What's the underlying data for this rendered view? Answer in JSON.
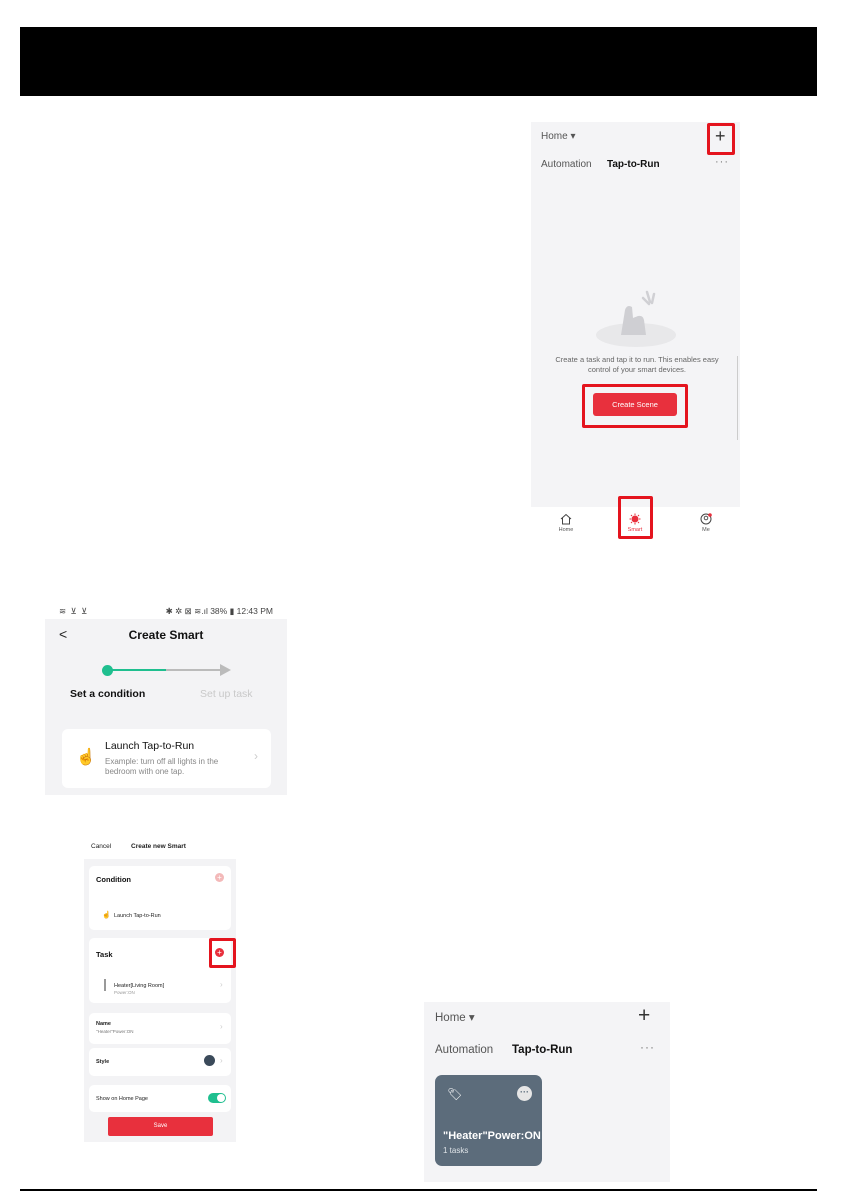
{
  "colors": {
    "accent_red": "#e8303d",
    "highlight_red": "#e4141e",
    "accent_green": "#1fbf8f",
    "card_slate": "#5c6c7b"
  },
  "screen1": {
    "home_label": "Home",
    "plus_icon": "+",
    "tab_automation": "Automation",
    "tab_tap": "Tap-to-Run",
    "more_dots": "···",
    "empty_text": "Create a task and tap it to run. This enables easy control of your smart devices.",
    "create_button": "Create Scene",
    "tabbar": [
      {
        "label": "Home",
        "icon": "house-icon"
      },
      {
        "label": "Smart",
        "icon": "smart-sun-icon"
      },
      {
        "label": "Me",
        "icon": "profile-icon"
      }
    ]
  },
  "screen2": {
    "status_left": "≋ ⊻ ⊻",
    "status_right": "✱ ✲ ⊠ ≋.ıl 38% ▮ 12:43 PM",
    "back": "<",
    "title": "Create Smart",
    "step1": "Set a condition",
    "step2": "Set up task",
    "card_label": "Launch Tap-to-Run",
    "card_desc": "Example: turn off all lights in the bedroom with one tap."
  },
  "screen3": {
    "cancel": "Cancel",
    "title": "Create new Smart",
    "condition_header": "Condition",
    "condition_item": "Launch Tap-to-Run",
    "task_header": "Task",
    "task_item": "Heater[Living Room]",
    "task_sub": "Power:ON",
    "name_label": "Name",
    "name_value": "\"Heater\"Power:ON",
    "style_label": "Style",
    "show_home": "Show on Home Page",
    "save": "Save"
  },
  "screen4": {
    "home_label": "Home",
    "plus_icon": "+",
    "tab_automation": "Automation",
    "tab_tap": "Tap-to-Run",
    "more_dots": "···",
    "card_name": "\"Heater\"Power:ON",
    "card_count": "1 tasks"
  }
}
